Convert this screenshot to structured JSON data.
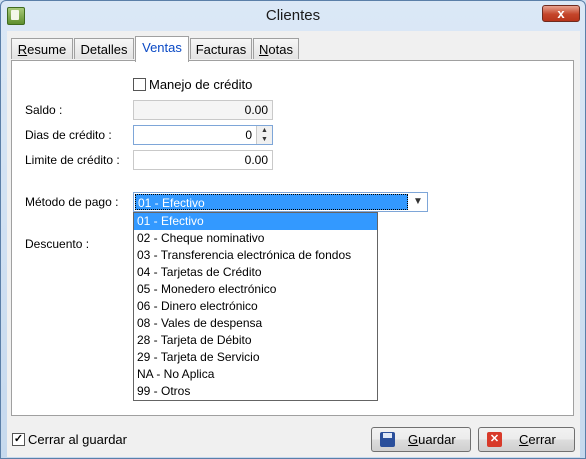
{
  "window": {
    "title": "Clientes",
    "close_glyph": "x"
  },
  "tabs": [
    {
      "label": "Resume",
      "hotkey": "R",
      "rest": "esume"
    },
    {
      "label": "Detalles"
    },
    {
      "label": "Ventas"
    },
    {
      "label": "Facturas"
    },
    {
      "label": "Notas",
      "hotkey": "N",
      "rest": "otas"
    }
  ],
  "ventas": {
    "manejo_credito": {
      "label": "Manejo de crédito",
      "checked": false
    },
    "saldo": {
      "label": "Saldo :",
      "value": "0.00"
    },
    "dias_credito": {
      "label": "Dias de crédito :",
      "value": "0"
    },
    "limite_credito": {
      "label": "Limite de crédito :",
      "value": "0.00"
    },
    "metodo_pago": {
      "label": "Método de pago :",
      "selected": "01 - Efectivo",
      "options": [
        "01 - Efectivo",
        "02 - Cheque nominativo",
        "03 - Transferencia electrónica de fondos",
        "04 - Tarjetas de Crédito",
        "05 - Monedero electrónico",
        "06 - Dinero electrónico",
        "08 - Vales de despensa",
        "28 - Tarjeta de Débito",
        "29 - Tarjeta de Servicio",
        "NA - No Aplica",
        "99 - Otros"
      ]
    },
    "descuento": {
      "label": "Descuento :"
    }
  },
  "footer": {
    "cerrar_al_guardar": {
      "label": "Cerrar al guardar",
      "checked": true
    },
    "guardar": {
      "label": "Guardar",
      "hotkey": "G",
      "rest": "uardar"
    },
    "cerrar": {
      "label": "Cerrar",
      "hotkey": "C",
      "rest": "errar"
    }
  },
  "icons": {
    "app": "contacts-card-icon",
    "save": "floppy-disk-icon",
    "cancel": "red-x-icon",
    "dropdown": "chevron-down-icon"
  }
}
